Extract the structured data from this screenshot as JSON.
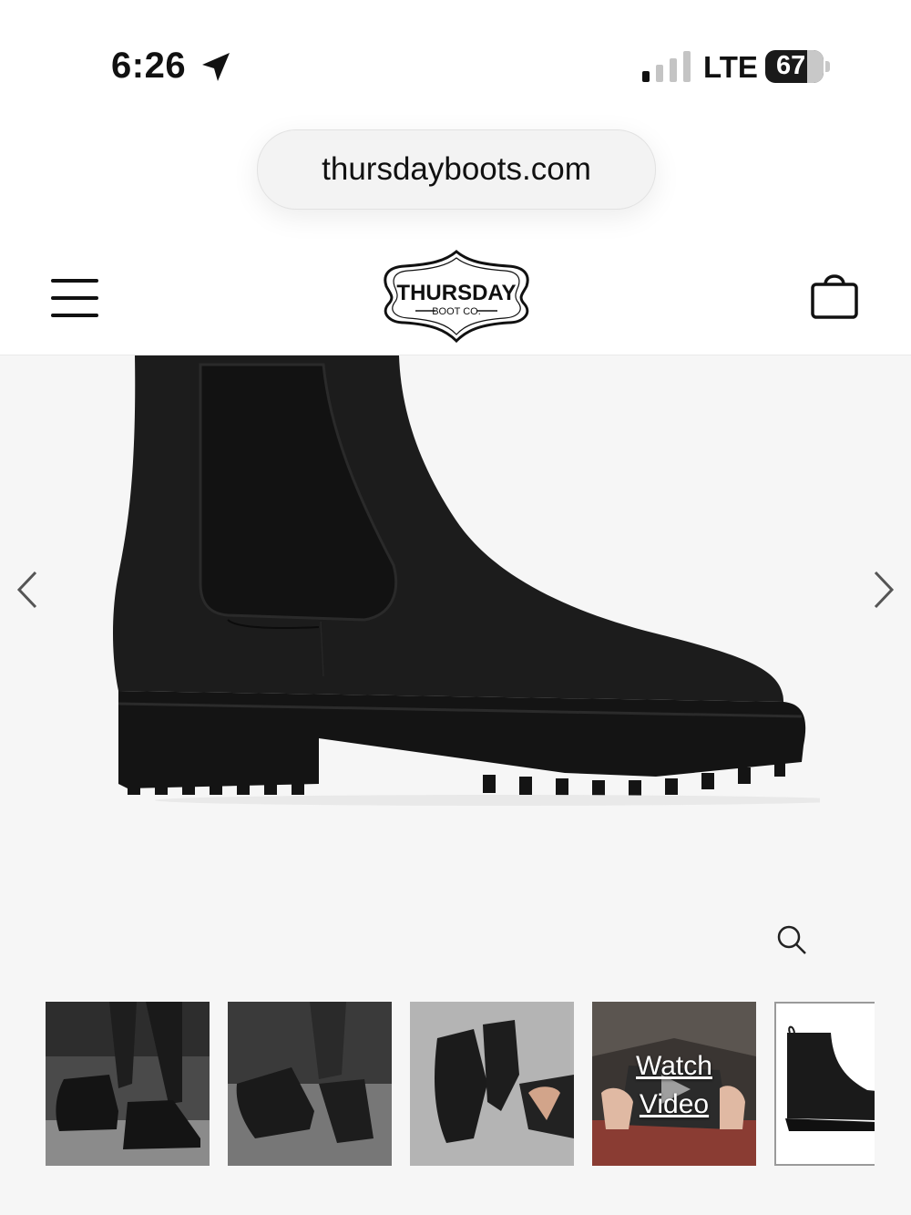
{
  "status_bar": {
    "time": "6:26",
    "network": "LTE",
    "battery": "67",
    "icons": [
      "location-arrow-icon",
      "signal-bars-icon",
      "battery-icon"
    ]
  },
  "browser": {
    "url": "thursdayboots.com"
  },
  "header": {
    "logo_top": "THURSDAY",
    "logo_bottom": "BOOT CO.",
    "icons": [
      "hamburger-menu-icon",
      "shopping-bag-icon"
    ]
  },
  "gallery": {
    "icons": [
      "chevron-left-icon",
      "chevron-right-icon",
      "zoom-icon"
    ],
    "thumbnails": [
      {
        "label": ""
      },
      {
        "label": ""
      },
      {
        "label": ""
      },
      {
        "label": "Watch Video",
        "line1": "Watch",
        "line2": "Video"
      },
      {
        "label": ""
      }
    ]
  },
  "colors": {
    "text": "#111111",
    "background": "#f6f6f6",
    "boot": "#1b1b1b"
  }
}
